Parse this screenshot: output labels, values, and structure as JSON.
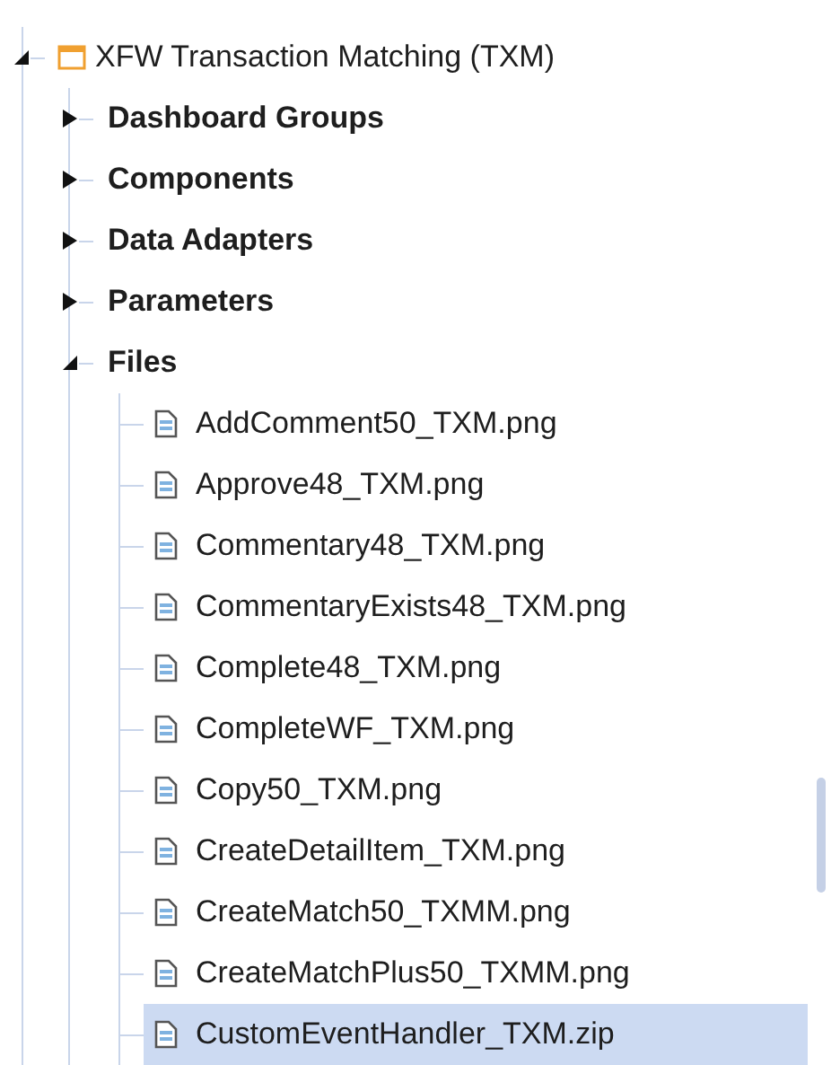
{
  "tree": {
    "label": "XFW Transaction Matching (TXM)",
    "kind": "solution",
    "expanded": true,
    "children": [
      {
        "label": "Dashboard Groups",
        "kind": "folder",
        "expanded": false
      },
      {
        "label": "Components",
        "kind": "folder",
        "expanded": false
      },
      {
        "label": "Data Adapters",
        "kind": "folder",
        "expanded": false
      },
      {
        "label": "Parameters",
        "kind": "folder",
        "expanded": false
      },
      {
        "label": "Files",
        "kind": "folder",
        "expanded": true,
        "children": [
          {
            "label": "AddComment50_TXM.png",
            "kind": "file",
            "selected": false
          },
          {
            "label": "Approve48_TXM.png",
            "kind": "file",
            "selected": false
          },
          {
            "label": "Commentary48_TXM.png",
            "kind": "file",
            "selected": false
          },
          {
            "label": "CommentaryExists48_TXM.png",
            "kind": "file",
            "selected": false
          },
          {
            "label": "Complete48_TXM.png",
            "kind": "file",
            "selected": false
          },
          {
            "label": "CompleteWF_TXM.png",
            "kind": "file",
            "selected": false
          },
          {
            "label": "Copy50_TXM.png",
            "kind": "file",
            "selected": false
          },
          {
            "label": "CreateDetailItem_TXM.png",
            "kind": "file",
            "selected": false
          },
          {
            "label": "CreateMatch50_TXMM.png",
            "kind": "file",
            "selected": false
          },
          {
            "label": "CreateMatchPlus50_TXMM.png",
            "kind": "file",
            "selected": false
          },
          {
            "label": "CustomEventHandler_TXM.zip",
            "kind": "file",
            "selected": true
          }
        ]
      }
    ]
  }
}
